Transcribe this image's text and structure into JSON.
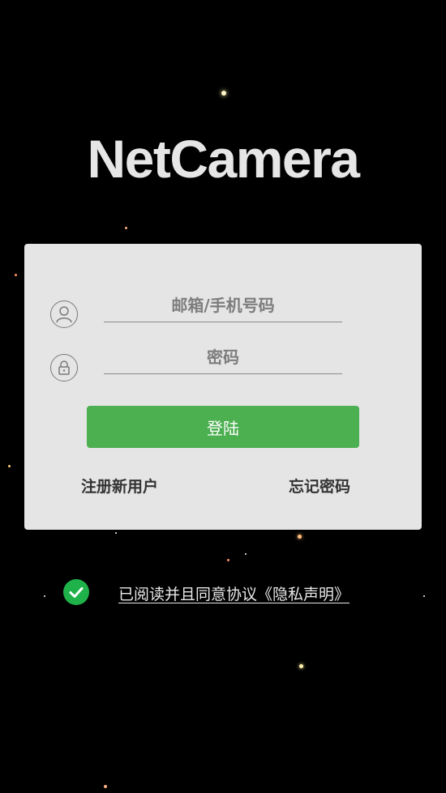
{
  "app": {
    "title": "NetCamera"
  },
  "login_form": {
    "account_placeholder": "邮箱/手机号码",
    "password_placeholder": "密码",
    "login_button_label": "登陆",
    "register_link": "注册新用户",
    "forgot_password_link": "忘记密码"
  },
  "agreement": {
    "checked": true,
    "text": "已阅读并且同意协议《隐私声明》"
  },
  "icons": {
    "account": "user-icon",
    "password": "lock-icon",
    "agreement": "checkmark-icon"
  },
  "colors": {
    "background": "#000000",
    "card": "#e5e5e5",
    "primary_button": "#4caf50",
    "check": "#1fb24a"
  }
}
